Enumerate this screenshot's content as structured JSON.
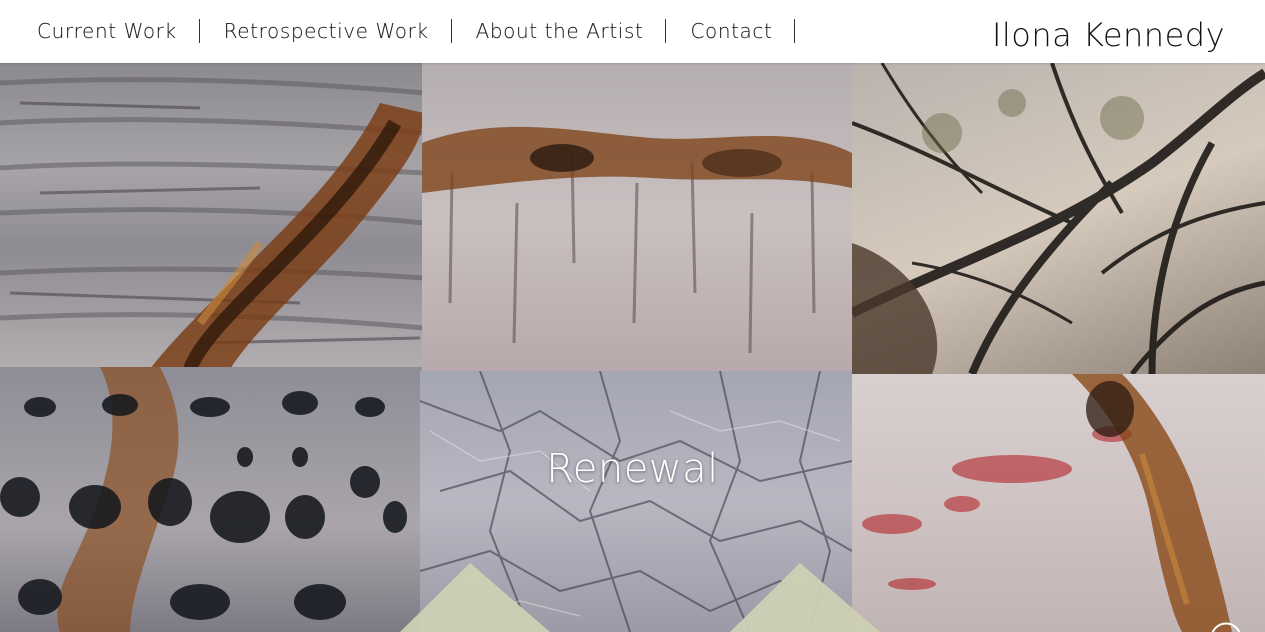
{
  "nav": {
    "items": [
      {
        "label": "Current Work"
      },
      {
        "label": "Retrospective Work"
      },
      {
        "label": "About the Artist"
      },
      {
        "label": "Contact"
      }
    ]
  },
  "site": {
    "title": "Ilona Kennedy"
  },
  "hero": {
    "title": "Renewal",
    "scroll_icon": "chevron-down-circle-icon",
    "tiles": [
      {
        "name": "artwork-rust-streak-tile"
      },
      {
        "name": "artwork-birch-bark-tile"
      },
      {
        "name": "artwork-tree-branches-tile"
      },
      {
        "name": "artwork-holes-texture-tile"
      },
      {
        "name": "artwork-cracked-branches-tile"
      },
      {
        "name": "artwork-red-rust-tile"
      }
    ]
  },
  "colors": {
    "header_bg": "#ffffff",
    "text": "#222222",
    "hero_text": "#ffffff",
    "rust": "#8a4a1e"
  }
}
